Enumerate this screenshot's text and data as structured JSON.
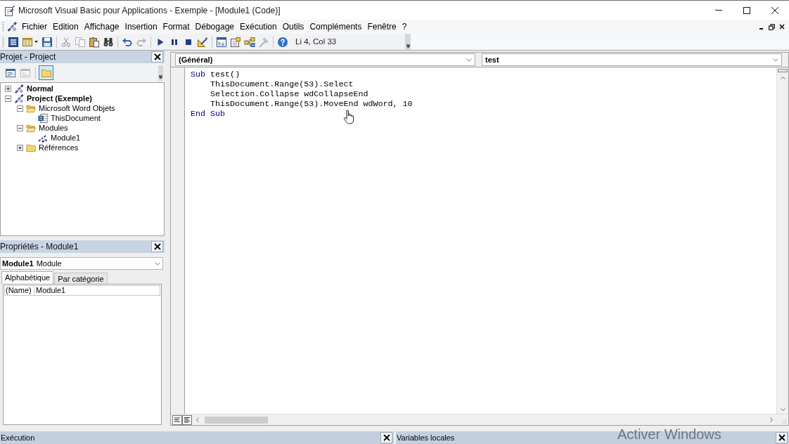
{
  "window": {
    "title": "Microsoft Visual Basic pour Applications - Exemple - [Module1 (Code)]"
  },
  "menu_bar": {
    "items": [
      "Fichier",
      "Edition",
      "Affichage",
      "Insertion",
      "Format",
      "Débogage",
      "Exécution",
      "Outils",
      "Compléments",
      "Fenêtre",
      "?"
    ]
  },
  "toolbar": {
    "groups": [
      [
        {
          "kind": "word",
          "disabled": false
        },
        {
          "kind": "userform",
          "disabled": false
        },
        {
          "kind": "save",
          "disabled": false
        }
      ],
      [
        {
          "kind": "cut",
          "disabled": true
        },
        {
          "kind": "copy",
          "disabled": true
        },
        {
          "kind": "paste",
          "disabled": false
        },
        {
          "kind": "find",
          "disabled": false
        }
      ],
      [
        {
          "kind": "undo",
          "disabled": false
        },
        {
          "kind": "redo",
          "disabled": true
        }
      ],
      [
        {
          "kind": "run",
          "disabled": false
        },
        {
          "kind": "pause",
          "disabled": false
        },
        {
          "kind": "reset",
          "disabled": false
        },
        {
          "kind": "design",
          "disabled": false
        }
      ],
      [
        {
          "kind": "explorer",
          "disabled": false
        },
        {
          "kind": "properties",
          "disabled": false
        },
        {
          "kind": "browser",
          "disabled": false
        },
        {
          "kind": "toolbox",
          "disabled": true
        }
      ],
      [
        {
          "kind": "help",
          "disabled": false
        }
      ]
    ],
    "position": "Li 4, Col 33"
  },
  "project_panel": {
    "title": "Projet - Project",
    "button_groups": [
      [
        {
          "kind": "code",
          "disabled": false,
          "pressed": false
        },
        {
          "kind": "object",
          "disabled": true,
          "pressed": false
        }
      ],
      [
        {
          "kind": "folders",
          "disabled": false,
          "pressed": true
        }
      ]
    ],
    "tree": [
      {
        "label": "Normal",
        "kind": "project",
        "expanded": false
      },
      {
        "label": "Project (Exemple)",
        "kind": "project",
        "expanded": true,
        "children": [
          {
            "label": "Microsoft Word Objets",
            "kind": "folder",
            "expanded": true,
            "children": [
              {
                "label": "ThisDocument",
                "kind": "document"
              }
            ]
          },
          {
            "label": "Modules",
            "kind": "folder",
            "expanded": true,
            "children": [
              {
                "label": "Module1",
                "kind": "module"
              }
            ]
          },
          {
            "label": "Références",
            "kind": "folder",
            "expanded": false
          }
        ]
      }
    ]
  },
  "properties_panel": {
    "title": "Propriétés - Module1",
    "object": {
      "name": "Module1",
      "type": "Module"
    },
    "tabs": [
      {
        "label": "Alphabétique",
        "selected": true
      },
      {
        "label": "Par catégorie",
        "selected": false
      }
    ],
    "rows": [
      {
        "name": "(Name)",
        "value": "Module1"
      }
    ]
  },
  "code_window": {
    "object_combo": "(Général)",
    "procedure_combo": "test",
    "lines": [
      {
        "tokens": [
          {
            "text": "Sub",
            "kind": "keyword"
          },
          {
            "text": " test()",
            "kind": "plain"
          }
        ]
      },
      {
        "tokens": [
          {
            "text": "    ThisDocument.Range(53).Select",
            "kind": "plain"
          }
        ]
      },
      {
        "tokens": [
          {
            "text": "    Selection.Collapse wdCollapseEnd",
            "kind": "plain"
          }
        ]
      },
      {
        "tokens": [
          {
            "text": "    ThisDocument.Range(53).MoveEnd wdWord, 10",
            "kind": "plain"
          }
        ]
      },
      {
        "tokens": [
          {
            "text": "End Sub",
            "kind": "keyword"
          }
        ]
      }
    ]
  },
  "bottom_panels": [
    {
      "title": "Exécution"
    },
    {
      "title": "Variables locales"
    }
  ],
  "activation_notice": "Activer Windows"
}
